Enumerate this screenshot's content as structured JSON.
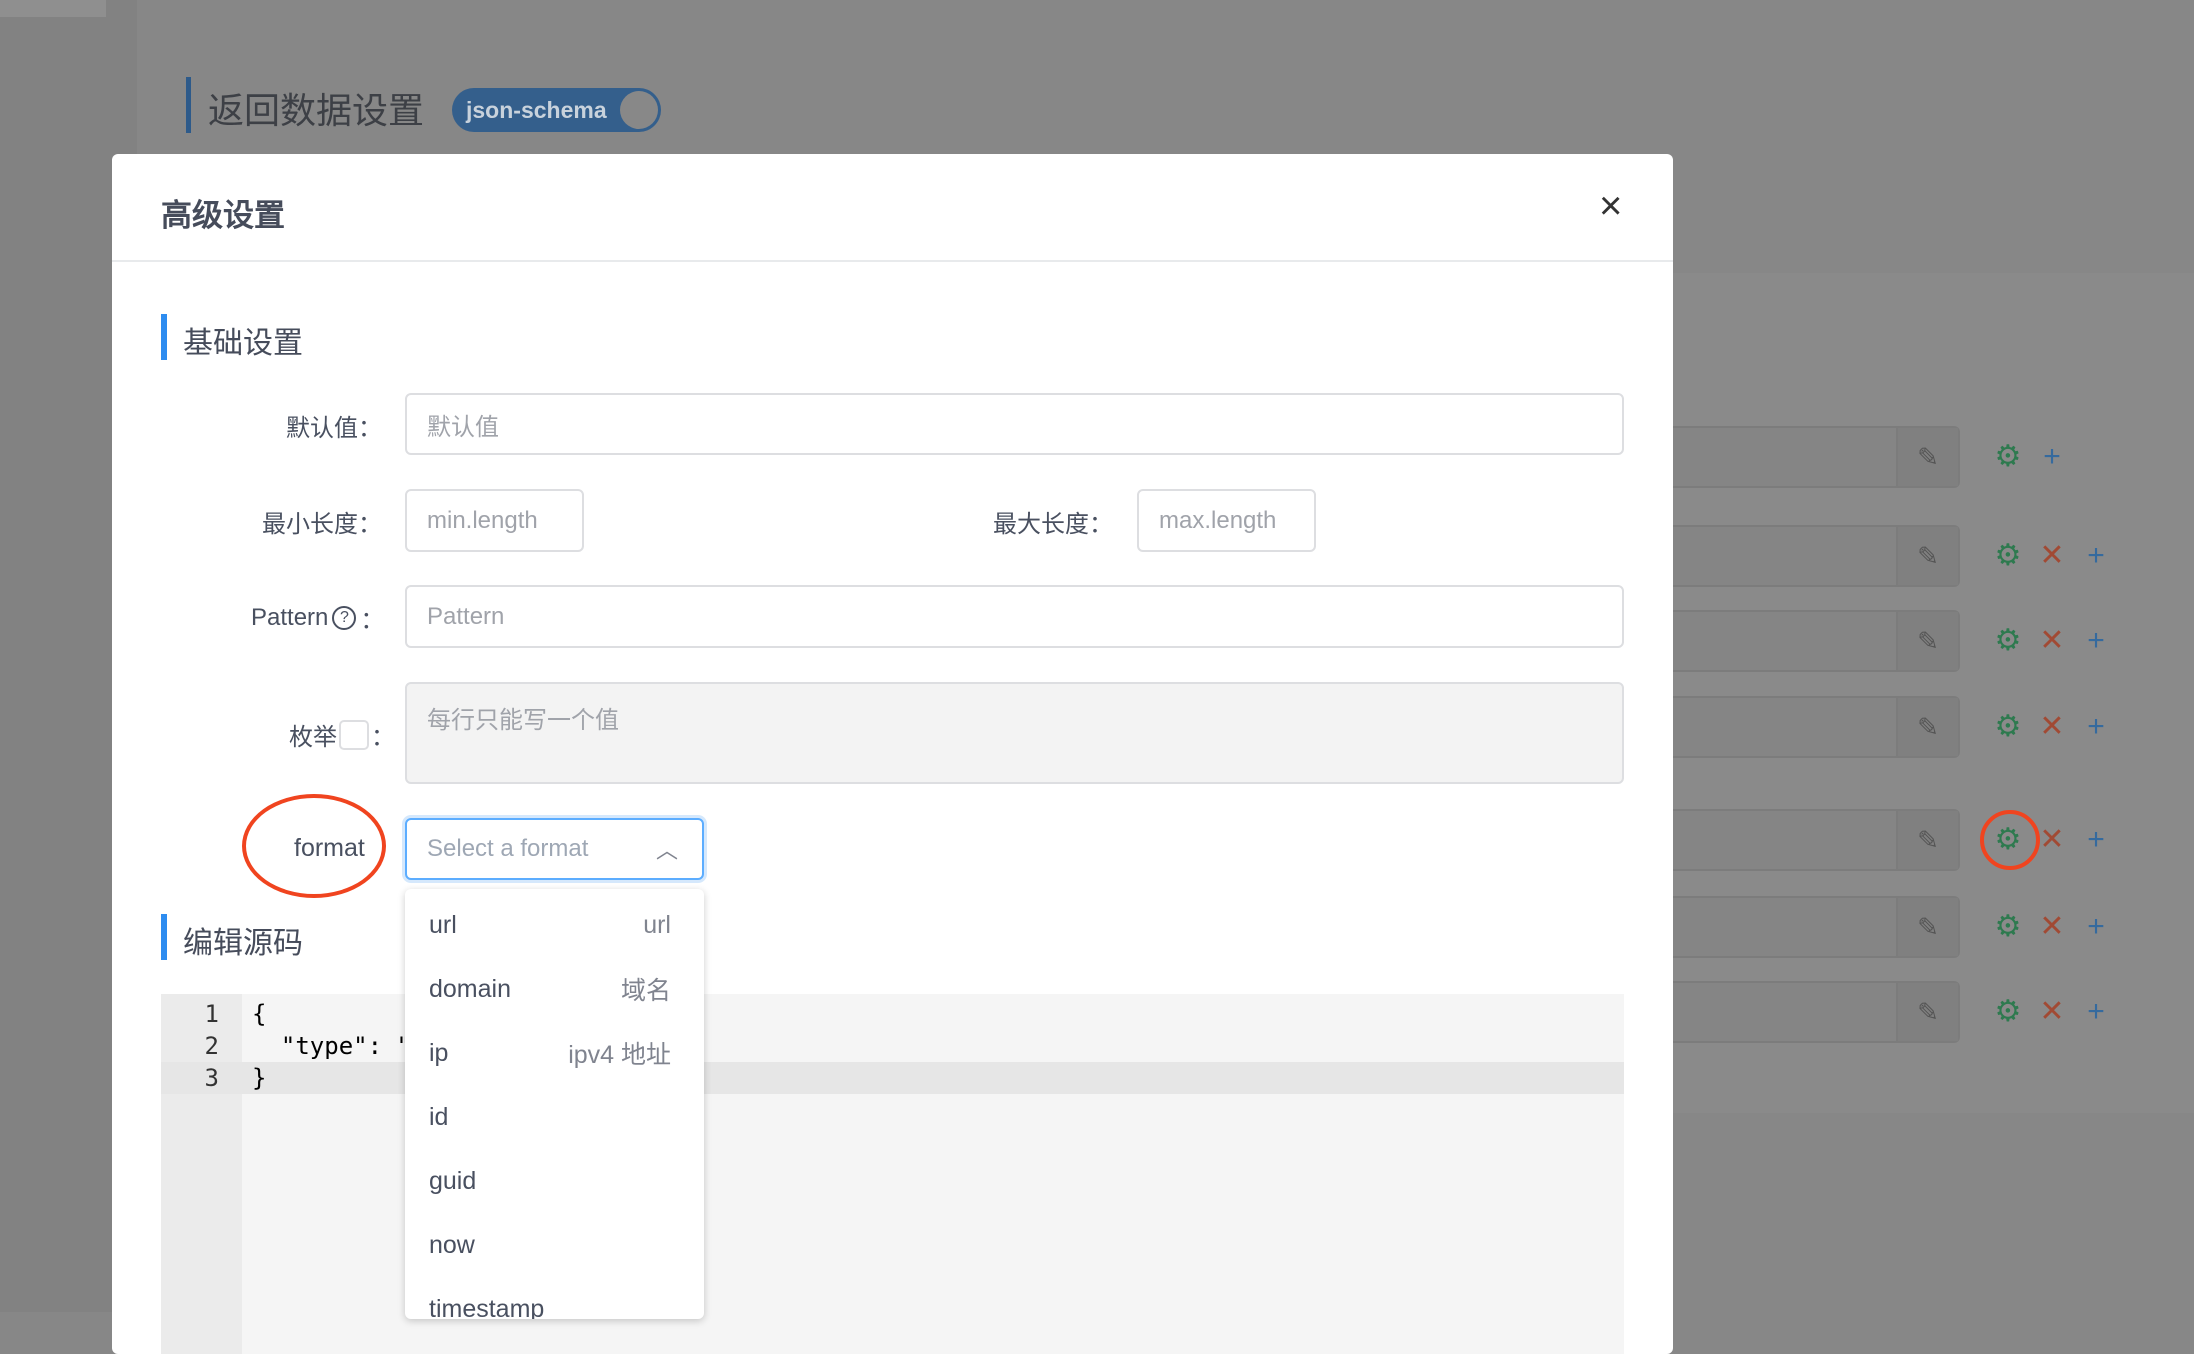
{
  "background": {
    "title": "返回数据设置",
    "toggle_label": "json-schema",
    "rows": [
      {
        "edit_icon": "pencil-icon",
        "has_delete": false
      },
      {
        "edit_icon": "pencil-icon",
        "has_delete": true
      },
      {
        "edit_icon": "pencil-icon",
        "has_delete": true
      },
      {
        "edit_icon": "pencil-icon",
        "has_delete": true
      },
      {
        "edit_icon": "pencil-icon",
        "has_delete": true,
        "highlighted": true
      },
      {
        "edit_icon": "pencil-icon",
        "has_delete": true
      },
      {
        "edit_icon": "pencil-icon",
        "has_delete": true
      }
    ]
  },
  "modal": {
    "title": "高级设置",
    "close_icon": "×",
    "basic_section": "基础设置",
    "default_label": "默认值：",
    "default_placeholder": "默认值",
    "min_label": "最小长度：",
    "min_placeholder": "min.length",
    "max_label": "最大长度：",
    "max_placeholder": "max.length",
    "pattern_label": "Pattern",
    "pattern_suffix": "：",
    "pattern_help": "?",
    "pattern_placeholder": "Pattern",
    "enum_label": "枚举",
    "enum_suffix": "：",
    "enum_placeholder": "每行只能写一个值",
    "format_label": "format",
    "format_placeholder": "Select a format",
    "format_options": [
      {
        "value": "url",
        "desc": "url"
      },
      {
        "value": "domain",
        "desc": "域名"
      },
      {
        "value": "ip",
        "desc": "ipv4 地址"
      },
      {
        "value": "id",
        "desc": ""
      },
      {
        "value": "guid",
        "desc": ""
      },
      {
        "value": "now",
        "desc": ""
      },
      {
        "value": "timestamp",
        "desc": ""
      }
    ],
    "source_section": "编辑源码",
    "code_lines": [
      {
        "n": "1",
        "text": "{"
      },
      {
        "n": "2",
        "text": "  \"type\": \""
      },
      {
        "n": "3",
        "text": "}"
      }
    ]
  },
  "colors": {
    "accent": "#2d8cf0",
    "annotation": "#f0441f",
    "gear": "#2e7a4f",
    "delete": "#a14a34",
    "add": "#356a9e"
  }
}
